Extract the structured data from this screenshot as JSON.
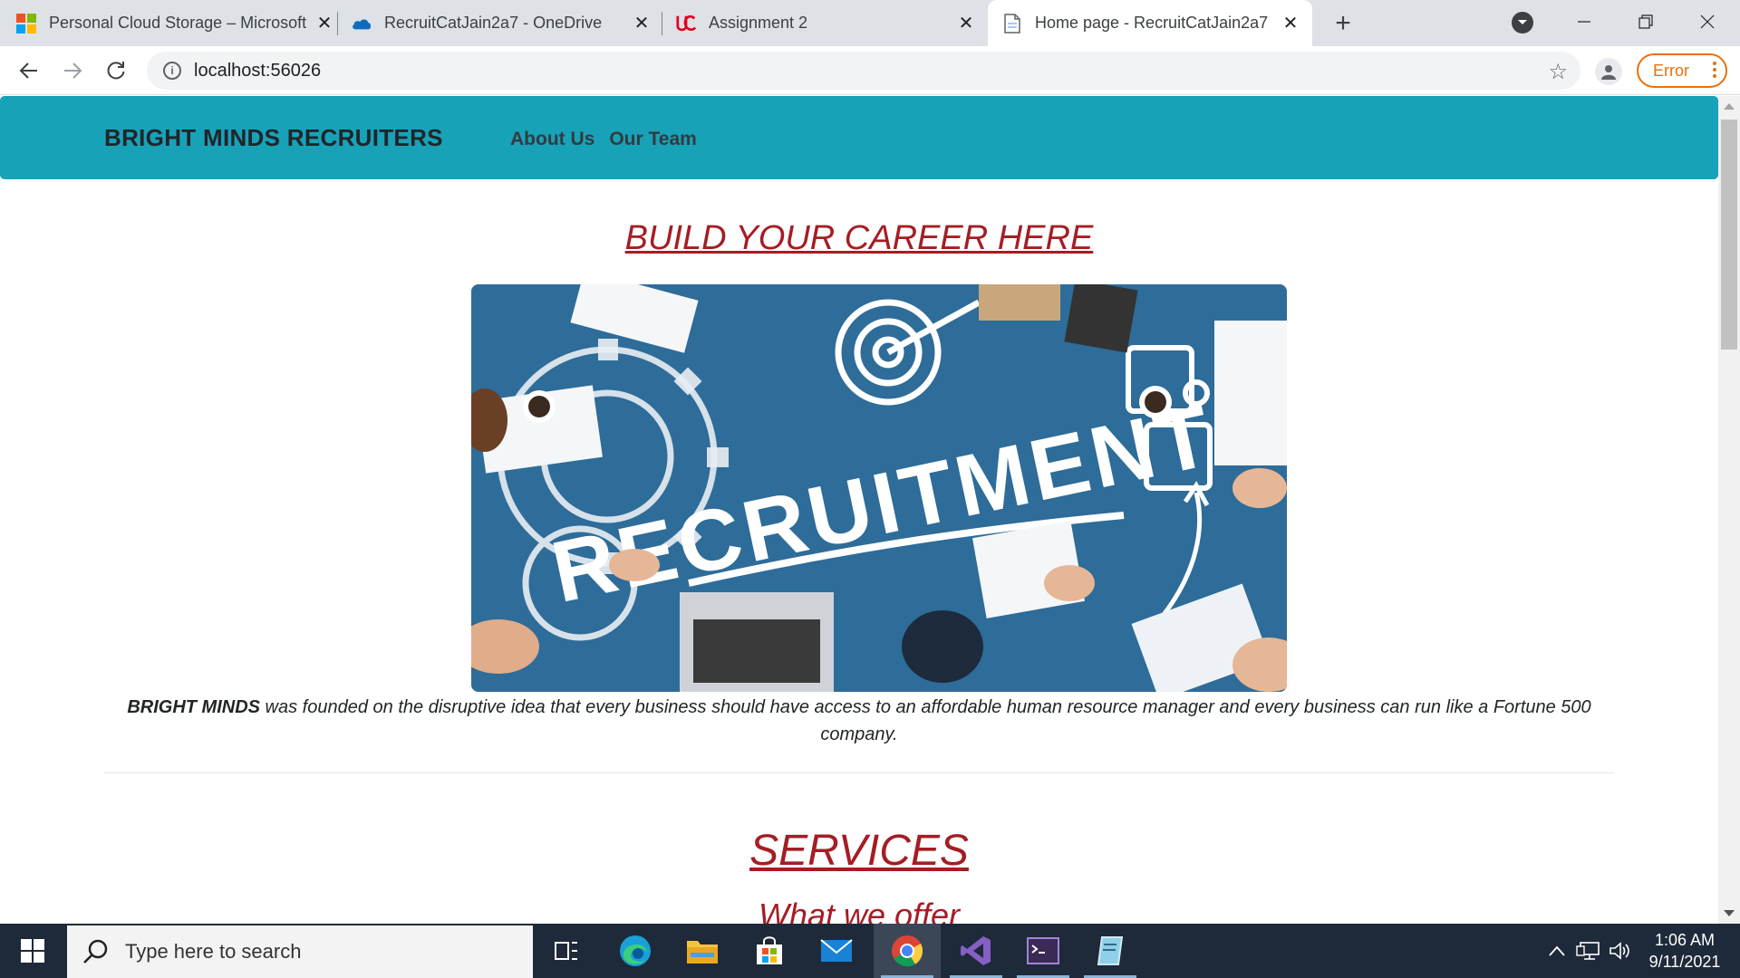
{
  "browser": {
    "tabs": [
      {
        "title": "Personal Cloud Storage – Microsoft",
        "icon": "microsoft-logo-icon",
        "active": false
      },
      {
        "title": "RecruitCatJain2a7 - OneDrive",
        "icon": "onedrive-cloud-icon",
        "active": false
      },
      {
        "title": "Assignment 2",
        "icon": "uc-logo-icon",
        "active": false
      },
      {
        "title": "Home page - RecruitCatJain2a7",
        "icon": "page-icon",
        "active": true
      }
    ],
    "url": "localhost:56026",
    "error_label": "Error"
  },
  "site": {
    "brand": "BRIGHT MINDS RECRUITERS",
    "nav": [
      "About Us",
      "Our Team"
    ],
    "hero_heading": "BUILD YOUR CAREER HERE",
    "hero_image_text": "RECRUITMENT",
    "intro_bold": "BRIGHT MINDS",
    "intro_text": " was founded on the disruptive idea that every business should have access to an affordable human resource manager and every business can run like a Fortune 500 company.",
    "services_heading": "SERVICES",
    "services_sub": "What we offer"
  },
  "taskbar": {
    "search_placeholder": "Type here to search",
    "time": "1:06 AM",
    "date": "9/11/2021"
  },
  "colors": {
    "navbar": "#17a2b8",
    "heading": "#a51d24",
    "taskbar": "#1e2a3a"
  }
}
